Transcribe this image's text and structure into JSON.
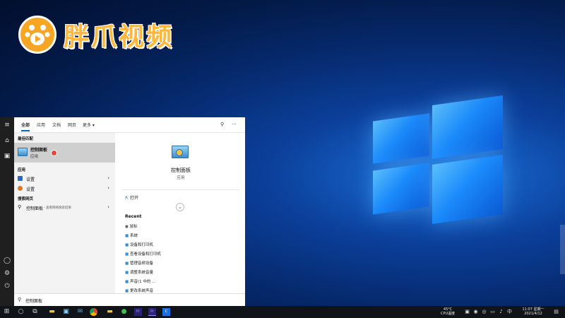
{
  "watermark": {
    "brand": "胖爪视频"
  },
  "search": {
    "tabs": [
      "全部",
      "应用",
      "文档",
      "网页",
      "更多 ▾"
    ],
    "best_match_header": "最佳匹配",
    "best_match": {
      "title": "控制面板",
      "subtitle": "应用"
    },
    "apps_header": "应用",
    "apps": [
      "设置",
      "设置"
    ],
    "web_header": "搜索网页",
    "web_item": {
      "title": "控制面板",
      "subtitle": " - 查看网络搜索结果"
    },
    "query": "控制面板"
  },
  "detail": {
    "title": "控制面板",
    "subtitle": "应用",
    "open_label": "打开",
    "recent_header": "Recent",
    "recent_items": [
      "鼠标",
      "系统",
      "设备和打印机",
      "查看设备和打印机",
      "管理音频设备",
      "调整系统音量",
      "声音(1 中的 ...",
      "更改系统声音"
    ]
  },
  "taskbar": {
    "temp": "45°C",
    "cpu": "CPU温度",
    "time": "11:07 星期一",
    "date": "2021/4/12",
    "input_method": "中"
  },
  "colors": {
    "accent": "#0067c0",
    "taskbar": "#101418",
    "watermark": "#ffb73b"
  }
}
